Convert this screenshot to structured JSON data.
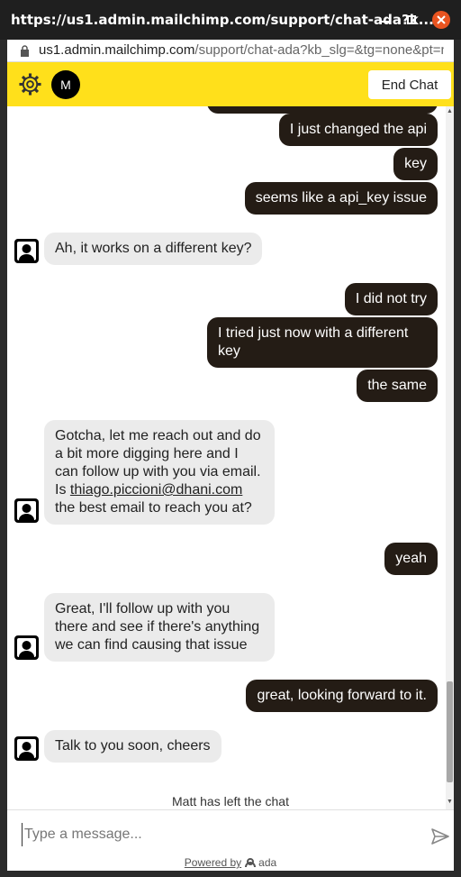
{
  "window": {
    "title": "https://us1.admin.mailchimp.com/support/chat-ada?k...",
    "url_host": "us1.admin.mailchimp.com",
    "url_path": "/support/chat-ada?kb_slg=&tg=none&pt=n..."
  },
  "header": {
    "avatar_letter": "M",
    "end_chat_label": "End Chat"
  },
  "messages": {
    "m1": "I just changed the api",
    "m2": "key",
    "m3": "seems like a api_key issue",
    "a1": "Ah, it works on a different key?",
    "m4": "I did not try",
    "m5_line1": "I tried just now with a different",
    "m5_line2": "key",
    "m6": "the same",
    "a2_line1": "Gotcha, let me reach out and do",
    "a2_line2": "a bit more digging here and I",
    "a2_line3": "can follow up with you via email.",
    "a2_is": "Is ",
    "a2_email": "thiago.piccioni@dhani.com",
    "a2_line5": "the best email to reach you at?",
    "m7": "yeah",
    "a3_line1": "Great, I'll follow up with you",
    "a3_line2": "there and see if there's anything",
    "a3_line3": "we can find causing that issue",
    "m8": "great, looking forward to it.",
    "a4": "Talk to you soon, cheers"
  },
  "status": {
    "left_chat": "Matt has left the chat"
  },
  "composer": {
    "placeholder": "Type a message...",
    "powered_by": "Powered by",
    "brand": "ada"
  },
  "colors": {
    "header_bg": "#ffe01b",
    "user_bubble": "#241c15",
    "agent_bubble": "#ebebeb",
    "close_button": "#e95420"
  },
  "icons": [
    "gear-icon",
    "lock-icon",
    "user-avatar-icon",
    "send-icon",
    "ada-logo-icon"
  ]
}
